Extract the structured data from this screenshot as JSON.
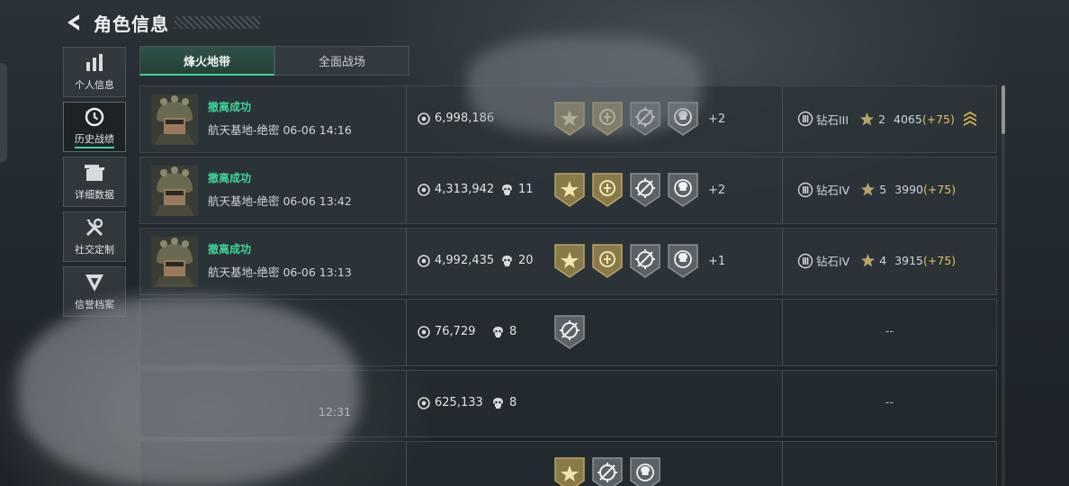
{
  "header": {
    "title": "角色信息",
    "back_icon": "back-arrow-icon"
  },
  "sidebar": {
    "items": [
      {
        "label": "个人信息",
        "icon": "bar-chart-icon",
        "active": false
      },
      {
        "label": "历史战绩",
        "icon": "clock-history-icon",
        "active": true
      },
      {
        "label": "详细数据",
        "icon": "folder-icon",
        "active": false
      },
      {
        "label": "社交定制",
        "icon": "tools-icon",
        "active": false
      },
      {
        "label": "信誉档案",
        "icon": "shield-emblem-icon",
        "active": false
      }
    ]
  },
  "tabs": [
    {
      "label": "烽火地带",
      "active": true
    },
    {
      "label": "全面战场",
      "active": false
    }
  ],
  "records": [
    {
      "status": "撤离成功",
      "map": "航天基地-绝密 06-06 14:16",
      "value": "6,998,186",
      "kills": "",
      "badges": [
        "gold-star",
        "gold-medal",
        "gray-target",
        "gray-skull"
      ],
      "more": "+2",
      "rank_tier": "III",
      "rank_name": "钻石III",
      "stars": "2",
      "points": "4065",
      "delta": "(+75)",
      "chevron": true
    },
    {
      "status": "撤离成功",
      "map": "航天基地-绝密 06-06 13:42",
      "value": "4,313,942",
      "kills": "11",
      "badges": [
        "gold-star",
        "gold-medal",
        "gray-target",
        "gray-skull"
      ],
      "more": "+2",
      "rank_tier": "IV",
      "rank_name": "钻石IV",
      "stars": "5",
      "points": "3990",
      "delta": "(+75)",
      "chevron": false
    },
    {
      "status": "撤离成功",
      "map": "航天基地-绝密 06-06 13:13",
      "value": "4,992,435",
      "kills": "20",
      "badges": [
        "gold-star",
        "gold-medal",
        "gray-target",
        "gray-skull"
      ],
      "more": "+1",
      "rank_tier": "IV",
      "rank_name": "钻石IV",
      "stars": "4",
      "points": "3915",
      "delta": "(+75)",
      "chevron": false
    },
    {
      "status": "",
      "map": "",
      "value": "76,729",
      "kills": "8",
      "badges": [
        "gray-target"
      ],
      "more": "",
      "rank_text": "--"
    },
    {
      "status": "",
      "map": "",
      "time": "12:31",
      "value": "625,133",
      "kills": "8",
      "badges": [],
      "more": "",
      "rank_text": "--"
    }
  ],
  "colors": {
    "accent": "#3dd6a0",
    "success": "#3fd69a",
    "gold": "#e2c45a",
    "badge_gold": "#8a7a4a",
    "badge_gray": "#5a6268"
  }
}
